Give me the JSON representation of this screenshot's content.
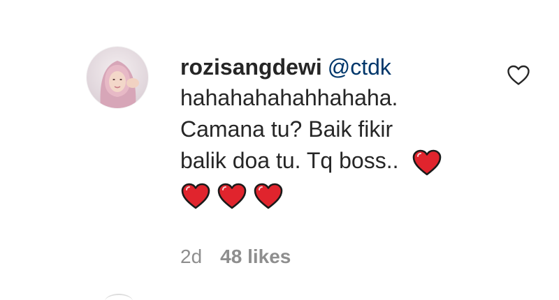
{
  "comment": {
    "username": "rozisangdewi",
    "mention": "@ctdk",
    "lines": [
      "hahahahahahhahaha.",
      "Camana tu? Baik fikir",
      "balik doa tu. Tq boss.."
    ],
    "emoji_icon": "red-heart-icon",
    "trailing_hearts": 3
  },
  "meta": {
    "time": "2d",
    "likes": "48 likes"
  },
  "icons": {
    "like": "heart-outline-icon"
  },
  "colors": {
    "text": "#262626",
    "mention": "#00376b",
    "secondary": "#8e8e8e",
    "heart": "#e0242d"
  }
}
